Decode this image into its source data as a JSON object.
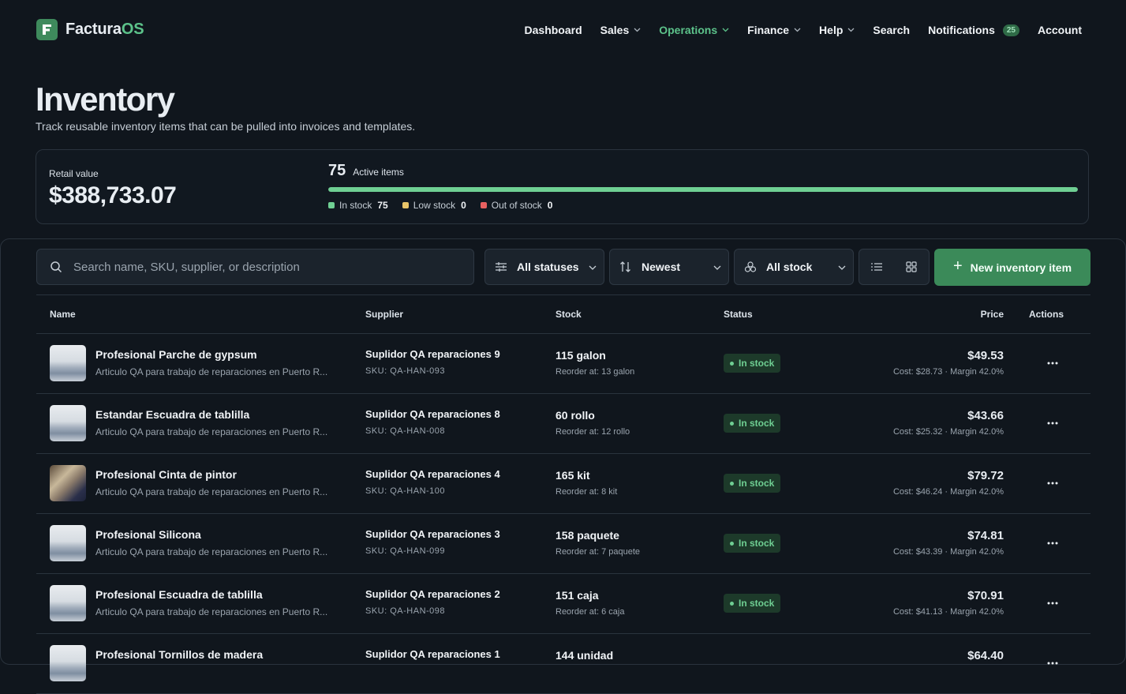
{
  "app": {
    "name_main": "Factura",
    "name_accent": "OS"
  },
  "nav": {
    "dashboard": "Dashboard",
    "sales": "Sales",
    "operations": "Operations",
    "finance": "Finance",
    "help": "Help",
    "search": "Search",
    "notifications": "Notifications",
    "notifications_count": "25",
    "account": "Account"
  },
  "page": {
    "title": "Inventory",
    "subtitle": "Track reusable inventory items that can be pulled into invoices and templates."
  },
  "stats": {
    "retail_label": "Retail value",
    "retail_value": "$388,733.07",
    "active_count": "75",
    "active_label": "Active items",
    "in_stock_fraction": 1.0,
    "legend": [
      {
        "label": "In stock",
        "value": "75",
        "color": "#6fcf93"
      },
      {
        "label": "Low stock",
        "value": "0",
        "color": "#e8c468"
      },
      {
        "label": "Out of stock",
        "value": "0",
        "color": "#e86060"
      }
    ]
  },
  "toolbar": {
    "search_placeholder": "Search name, SKU, supplier, or description",
    "status_filter": "All statuses",
    "sort": "Newest",
    "stock_filter": "All stock",
    "new_button": "New inventory item"
  },
  "table": {
    "headers": {
      "name": "Name",
      "supplier": "Supplier",
      "stock": "Stock",
      "status": "Status",
      "price": "Price",
      "actions": "Actions"
    },
    "rows": [
      {
        "name": "Profesional Parche de gypsum",
        "desc": "Articulo QA para trabajo de reparaciones en Puerto R...",
        "supplier": "Suplidor QA reparaciones 9",
        "sku": "SKU: QA-HAN-093",
        "stock": "115 galon",
        "reorder": "Reorder at: 13 galon",
        "status": "In stock",
        "price": "$49.53",
        "cost": "Cost: $28.73 · Margin 42.0%"
      },
      {
        "name": "Estandar Escuadra de tablilla",
        "desc": "Articulo QA para trabajo de reparaciones en Puerto R...",
        "supplier": "Suplidor QA reparaciones 8",
        "sku": "SKU: QA-HAN-008",
        "stock": "60 rollo",
        "reorder": "Reorder at: 12 rollo",
        "status": "In stock",
        "price": "$43.66",
        "cost": "Cost: $25.32 · Margin 42.0%"
      },
      {
        "name": "Profesional Cinta de pintor",
        "desc": "Articulo QA para trabajo de reparaciones en Puerto R...",
        "supplier": "Suplidor QA reparaciones 4",
        "sku": "SKU: QA-HAN-100",
        "stock": "165 kit",
        "reorder": "Reorder at: 8 kit",
        "status": "In stock",
        "price": "$79.72",
        "cost": "Cost: $46.24 · Margin 42.0%"
      },
      {
        "name": "Profesional Silicona",
        "desc": "Articulo QA para trabajo de reparaciones en Puerto R...",
        "supplier": "Suplidor QA reparaciones 3",
        "sku": "SKU: QA-HAN-099",
        "stock": "158 paquete",
        "reorder": "Reorder at: 7 paquete",
        "status": "In stock",
        "price": "$74.81",
        "cost": "Cost: $43.39 · Margin 42.0%"
      },
      {
        "name": "Profesional Escuadra de tablilla",
        "desc": "Articulo QA para trabajo de reparaciones en Puerto R...",
        "supplier": "Suplidor QA reparaciones 2",
        "sku": "SKU: QA-HAN-098",
        "stock": "151 caja",
        "reorder": "Reorder at: 6 caja",
        "status": "In stock",
        "price": "$70.91",
        "cost": "Cost: $41.13 · Margin 42.0%"
      },
      {
        "name": "Profesional Tornillos de madera",
        "desc": "",
        "supplier": "Suplidor QA reparaciones 1",
        "sku": "",
        "stock": "144 unidad",
        "reorder": "",
        "status": "",
        "price": "$64.40",
        "cost": ""
      }
    ]
  }
}
